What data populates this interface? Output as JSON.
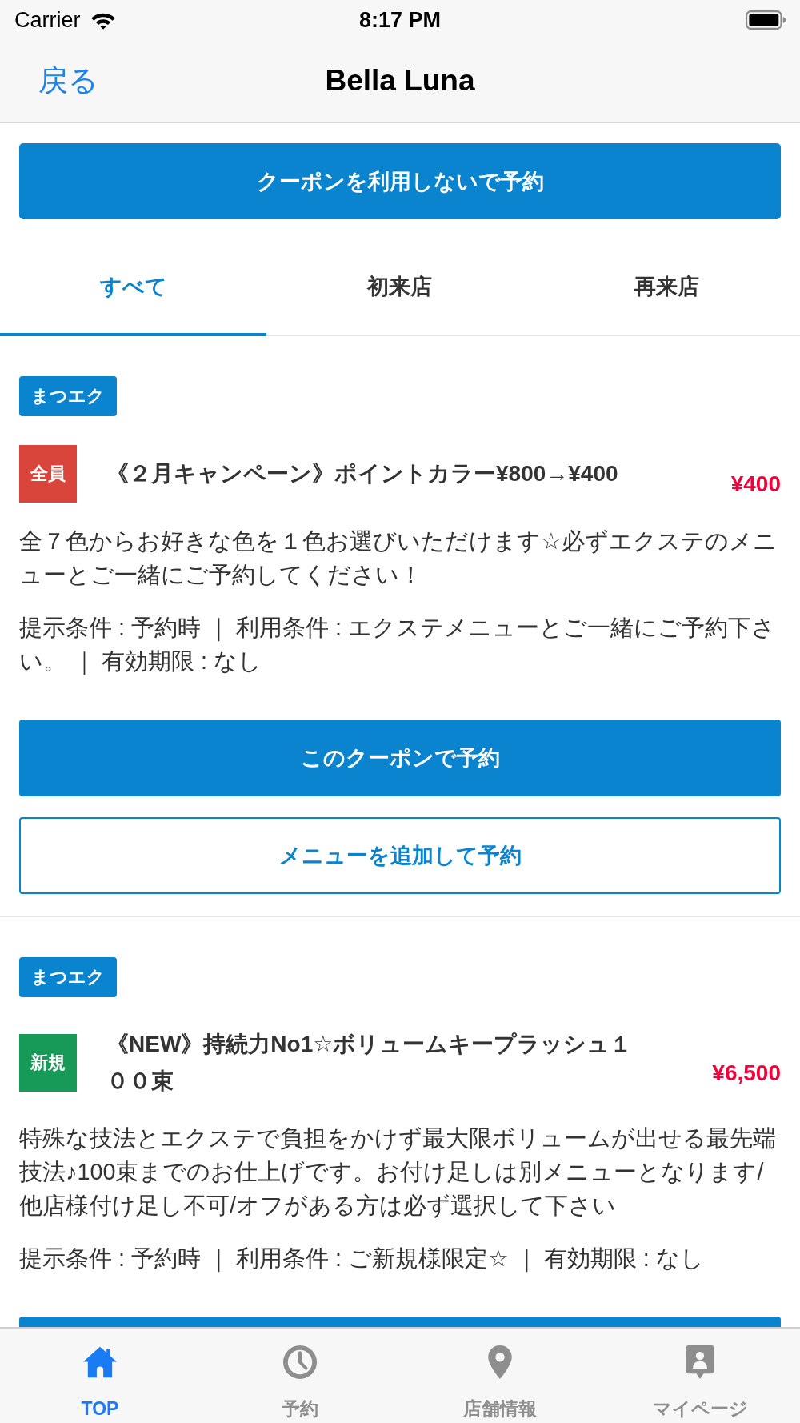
{
  "status_bar": {
    "carrier": "Carrier",
    "time": "8:17 PM"
  },
  "nav_bar": {
    "back": "戻る",
    "title": "Bella Luna"
  },
  "primary_button": "クーポンを利用しないで予約",
  "tabs": [
    {
      "label": "すべて",
      "selected": true
    },
    {
      "label": "初来店",
      "selected": false
    },
    {
      "label": "再来店",
      "selected": false
    }
  ],
  "coupons": [
    {
      "category": "まつエク",
      "badge": {
        "label": "全員",
        "color": "#d9453a"
      },
      "title": "《２月キャンペーン》ポイントカラー¥800→¥400",
      "price": "¥400",
      "description": "全７色からお好きな色を１色お選びいただけます☆必ずエクステのメニューとご一緒にご予約してください！",
      "conditions": "提示条件 : 予約時 ｜ 利用条件 : エクステメニューとご一緒にご予約下さい。 ｜ 有効期限 : なし",
      "buttons": [
        {
          "label": "このクーポンで予約",
          "kind": "filled"
        },
        {
          "label": "メニューを追加して予約",
          "kind": "outline"
        }
      ]
    },
    {
      "category": "まつエク",
      "badge": {
        "label": "新規",
        "color": "#179a57"
      },
      "title": "《NEW》持続力No1☆ボリュームキープラッシュ１００束",
      "price": "¥6,500",
      "description": "特殊な技法とエクステで負担をかけず最大限ボリュームが出せる最先端技法♪100束までのお仕上げです。お付け足しは別メニューとなります/他店様付け足し不可/オフがある方は必ず選択して下さい",
      "conditions": "提示条件 : 予約時 ｜ 利用条件 : ご新規様限定☆ ｜ 有効期限 : なし",
      "buttons": [
        {
          "kind": "filled"
        }
      ]
    }
  ],
  "tab_bar": [
    {
      "label": "TOP",
      "kind": "home",
      "selected": true
    },
    {
      "label": "予約",
      "kind": "clock",
      "selected": false
    },
    {
      "label": "店舗情報",
      "kind": "pin",
      "selected": false
    },
    {
      "label": "マイページ",
      "kind": "profile",
      "selected": false
    }
  ]
}
